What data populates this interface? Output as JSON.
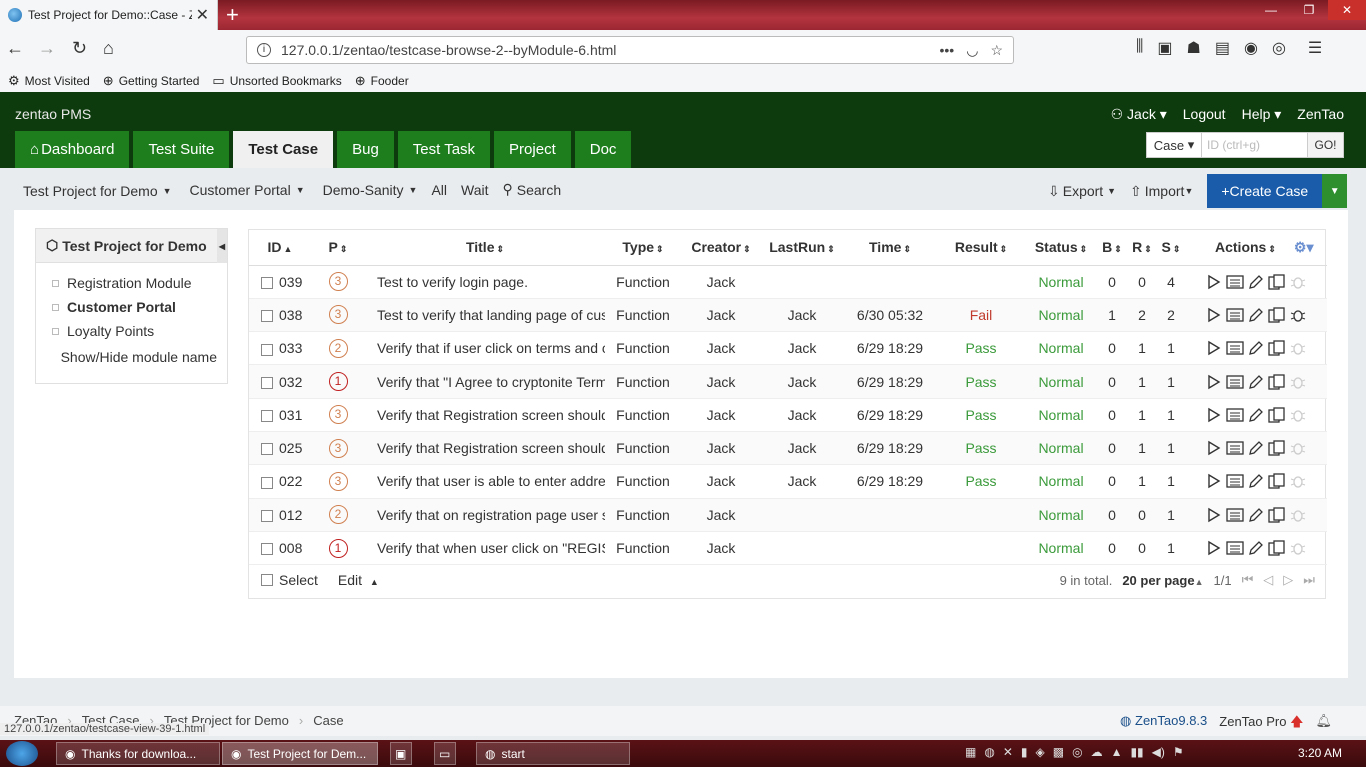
{
  "browser": {
    "tab_title": "Test Project for Demo::Case - Z",
    "url": "127.0.0.1/zentao/testcase-browse-2--byModule-6.html",
    "bookmarks": [
      "Most Visited",
      "Getting Started",
      "Unsorted Bookmarks",
      "Fooder"
    ]
  },
  "header": {
    "brand": "zentao PMS",
    "user": "Jack",
    "logout": "Logout",
    "help": "Help",
    "zentao": "ZenTao",
    "nav": [
      "Dashboard",
      "Test Suite",
      "Test Case",
      "Bug",
      "Test Task",
      "Project",
      "Doc"
    ],
    "active_nav": "Test Case",
    "search_type": "Case",
    "search_placeholder": "ID (ctrl+g)",
    "search_go": "GO!"
  },
  "subnav": {
    "product": "Test Project for Demo",
    "module": "Customer Portal",
    "suite": "Demo-Sanity",
    "all": "All",
    "wait": "Wait",
    "search": "Search",
    "export": "Export",
    "import": "Import",
    "create": "Create Case"
  },
  "sidebar": {
    "title": "Test Project for Demo",
    "modules": [
      "Registration Module",
      "Customer Portal",
      "Loyalty Points"
    ],
    "active_module": "Customer Portal",
    "show_hide": "Show/Hide module name"
  },
  "table": {
    "headers": [
      "ID",
      "P",
      "Title",
      "Type",
      "Creator",
      "LastRun",
      "Time",
      "Result",
      "Status",
      "B",
      "R",
      "S",
      "Actions"
    ],
    "rows": [
      {
        "id": "039",
        "p": "3",
        "title": "Test to verify login page.",
        "type": "Function",
        "creator": "Jack",
        "lastrun": "",
        "time": "",
        "result": "",
        "status": "Normal",
        "b": "0",
        "r": "0",
        "s": "4"
      },
      {
        "id": "038",
        "p": "3",
        "title": "Test to verify that landing page of cust",
        "type": "Function",
        "creator": "Jack",
        "lastrun": "Jack",
        "time": "6/30 05:32",
        "result": "Fail",
        "status": "Normal",
        "b": "1",
        "r": "2",
        "s": "2"
      },
      {
        "id": "033",
        "p": "2",
        "title": "Verify that if user click on terms and c",
        "type": "Function",
        "creator": "Jack",
        "lastrun": "Jack",
        "time": "6/29 18:29",
        "result": "Pass",
        "status": "Normal",
        "b": "0",
        "r": "1",
        "s": "1"
      },
      {
        "id": "032",
        "p": "1",
        "title": "Verify that \"I Agree to cryptonite Terms",
        "type": "Function",
        "creator": "Jack",
        "lastrun": "Jack",
        "time": "6/29 18:29",
        "result": "Pass",
        "status": "Normal",
        "b": "0",
        "r": "1",
        "s": "1"
      },
      {
        "id": "031",
        "p": "3",
        "title": "Verify that Registration screen should",
        "type": "Function",
        "creator": "Jack",
        "lastrun": "Jack",
        "time": "6/29 18:29",
        "result": "Pass",
        "status": "Normal",
        "b": "0",
        "r": "1",
        "s": "1"
      },
      {
        "id": "025",
        "p": "3",
        "title": "Verify that Registration screen should",
        "type": "Function",
        "creator": "Jack",
        "lastrun": "Jack",
        "time": "6/29 18:29",
        "result": "Pass",
        "status": "Normal",
        "b": "0",
        "r": "1",
        "s": "1"
      },
      {
        "id": "022",
        "p": "3",
        "title": "Verify that user is able to enter addres",
        "type": "Function",
        "creator": "Jack",
        "lastrun": "Jack",
        "time": "6/29 18:29",
        "result": "Pass",
        "status": "Normal",
        "b": "0",
        "r": "1",
        "s": "1"
      },
      {
        "id": "012",
        "p": "2",
        "title": "Verify that on registration page user sl",
        "type": "Function",
        "creator": "Jack",
        "lastrun": "",
        "time": "",
        "result": "",
        "status": "Normal",
        "b": "0",
        "r": "0",
        "s": "1"
      },
      {
        "id": "008",
        "p": "1",
        "title": "Verify that when user click on \"REGIS",
        "type": "Function",
        "creator": "Jack",
        "lastrun": "",
        "time": "",
        "result": "",
        "status": "Normal",
        "b": "0",
        "r": "0",
        "s": "1"
      }
    ],
    "footer": {
      "select": "Select",
      "edit": "Edit",
      "total": "9 in total.",
      "per_page": "20 per page",
      "pages": "1/1"
    }
  },
  "footer": {
    "crumbs": [
      "ZenTao",
      "Test Case",
      "Test Project for Demo",
      "Case"
    ],
    "version": "ZenTao9.8.3",
    "pro": "ZenTao Pro",
    "status_url": "127.0.0.1/zentao/testcase-view-39-1.html"
  },
  "taskbar": {
    "items": [
      "Thanks for downloa...",
      "Test Project for Dem...",
      "start"
    ],
    "clock": "3:20 AM"
  },
  "colors": {
    "header_bg": "#0d3b0d",
    "nav_bg": "#1e7e1e",
    "create_bg": "#1a5caa",
    "pass": "#3a9a3a",
    "fail": "#c0392b"
  }
}
